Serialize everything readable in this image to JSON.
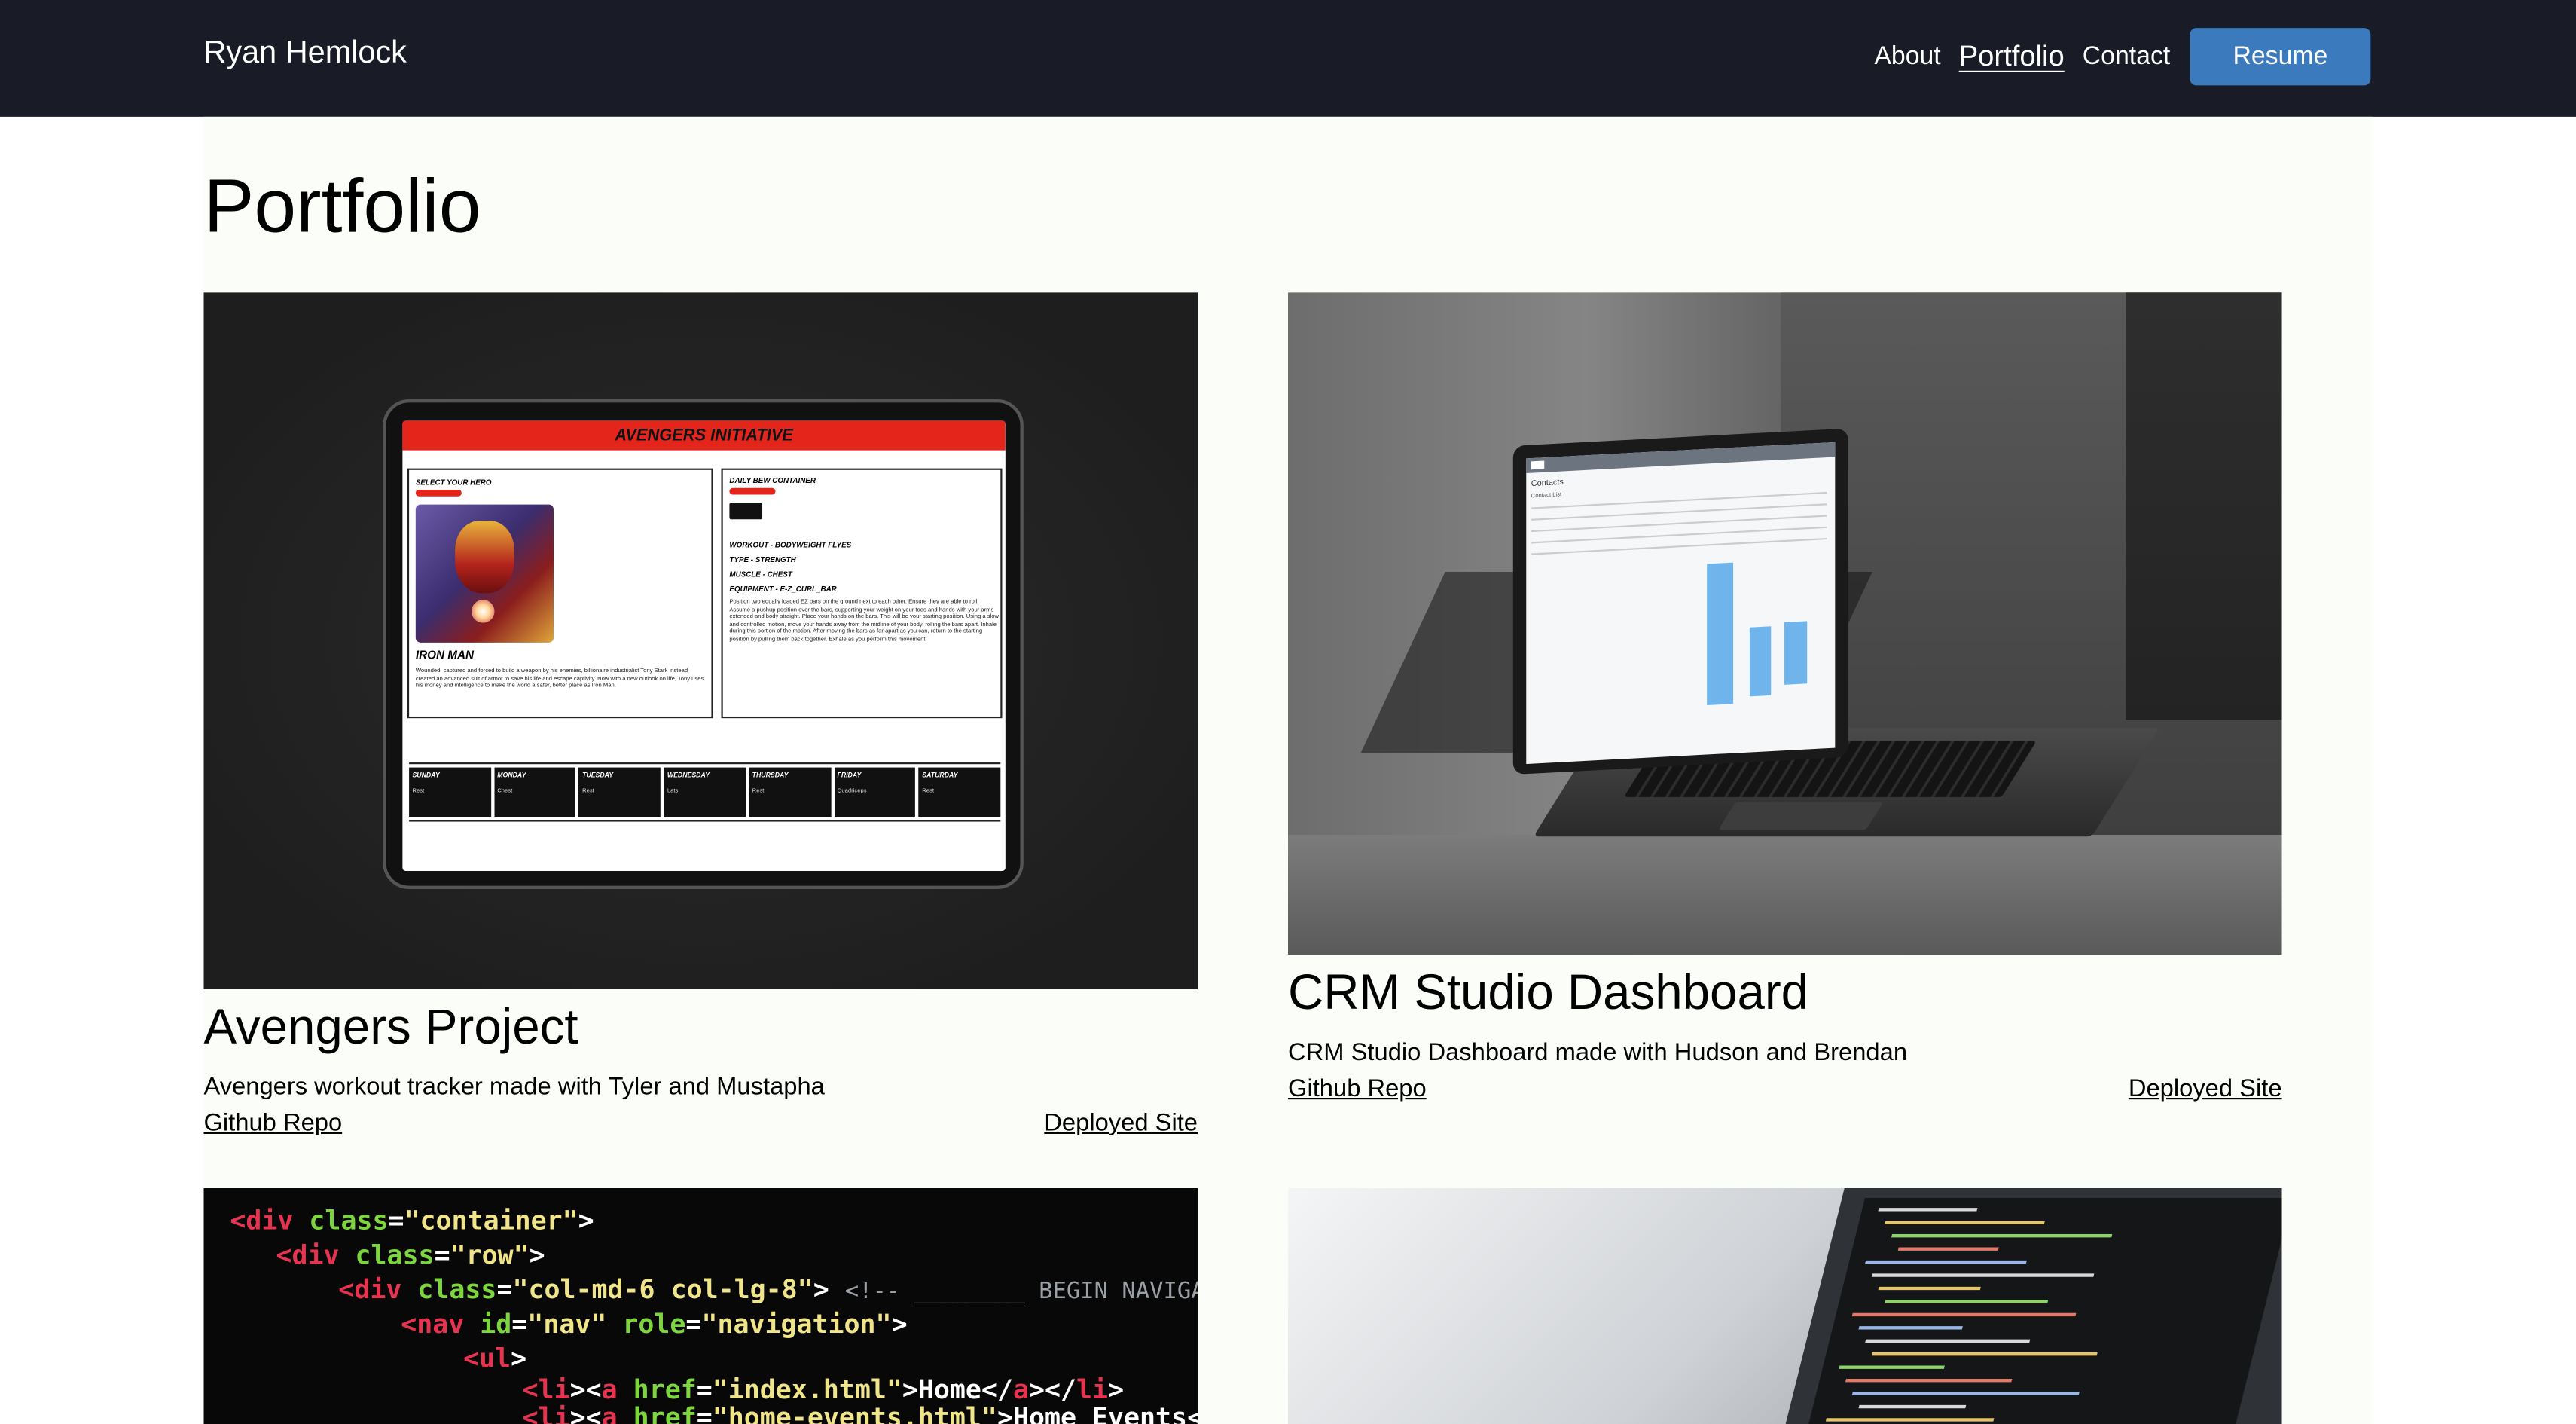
{
  "nav": {
    "brand": "Ryan Hemlock",
    "links": [
      "About",
      "Portfolio",
      "Contact"
    ],
    "active": "Portfolio",
    "resume_label": "Resume",
    "colors": {
      "bar": "#191b26",
      "button": "#3b7bbd"
    }
  },
  "page": {
    "title": "Portfolio"
  },
  "projects": [
    {
      "title": "Avengers Project",
      "description": "Avengers workout tracker made with Tyler and Mustapha",
      "repo_label": "Github Repo",
      "site_label": "Deployed Site",
      "mockup": {
        "header": "AVENGERS INITIATIVE",
        "select_label": "SELECT YOUR HERO",
        "hero_name": "IRON MAN",
        "hero_bio": "Wounded, captured and forced to build a weapon by his enemies, billionaire industrialist Tony Stark instead created an advanced suit of armor to save his life and escape captivity. Now with a new outlook on life, Tony uses his money and intelligence to make the world a safer, better place as Iron Man.",
        "daily_label": "DAILY BEW CONTAINER",
        "workout_lines": [
          "WORKOUT - BODYWEIGHT FLYES",
          "TYPE - STRENGTH",
          "MUSCLE - CHEST",
          "EQUIPMENT - E-Z_CURL_BAR"
        ],
        "instructions": "Position two equally loaded EZ bars on the ground next to each other. Ensure they are able to roll. Assume a pushup position over the bars, supporting your weight on your toes and hands with your arms extended and body straight. Place your hands on the bars. This will be your starting position. Using a slow and controlled motion, move your hands away from the midline of your body, rolling the bars apart. Inhale during this portion of the motion. After moving the bars as far apart as you can, return to the starting position by pulling them back together. Exhale as you perform this movement.",
        "days": [
          {
            "name": "SUNDAY",
            "value": "Rest"
          },
          {
            "name": "MONDAY",
            "value": "Chest"
          },
          {
            "name": "TUESDAY",
            "value": "Rest"
          },
          {
            "name": "WEDNESDAY",
            "value": "Lats"
          },
          {
            "name": "THURSDAY",
            "value": "Rest"
          },
          {
            "name": "FRIDAY",
            "value": "Quadriceps"
          },
          {
            "name": "SATURDAY",
            "value": "Rest"
          }
        ]
      }
    },
    {
      "title": "CRM Studio Dashboard",
      "description": "CRM Studio Dashboard made with Hudson and Brendan",
      "repo_label": "Github Repo",
      "site_label": "Deployed Site",
      "mockup": {
        "section": "Contacts",
        "sub": "Contact List"
      }
    },
    {
      "code_lines": [
        {
          "segments": [
            [
              "tag",
              "<div "
            ],
            [
              "attr",
              "class"
            ],
            [
              "plain",
              "="
            ],
            [
              "str",
              "\"container\""
            ],
            [
              "plain",
              ">"
            ]
          ]
        },
        {
          "segments": [
            [
              "tag",
              "<div "
            ],
            [
              "attr",
              "class"
            ],
            [
              "plain",
              "="
            ],
            [
              "str",
              "\"row\""
            ],
            [
              "plain",
              ">"
            ]
          ]
        },
        {
          "segments": [
            [
              "tag",
              "<div "
            ],
            [
              "attr",
              "class"
            ],
            [
              "plain",
              "="
            ],
            [
              "str",
              "\"col-md-6 col-lg-8\""
            ],
            [
              "plain",
              "> "
            ],
            [
              "dim",
              "<!-- ________ BEGIN NAVIGATION"
            ]
          ]
        },
        {
          "segments": [
            [
              "tag",
              "<nav "
            ],
            [
              "attr",
              "id"
            ],
            [
              "plain",
              "="
            ],
            [
              "str",
              "\"nav\" "
            ],
            [
              "attr",
              "role"
            ],
            [
              "plain",
              "="
            ],
            [
              "str",
              "\"navigation\""
            ],
            [
              "plain",
              ">"
            ]
          ]
        },
        {
          "segments": [
            [
              "tag",
              "<ul"
            ],
            [
              "plain",
              ">"
            ]
          ]
        },
        {
          "segments": [
            [
              "tag",
              "<li"
            ],
            [
              "plain",
              "><"
            ],
            [
              "tag",
              "a "
            ],
            [
              "attr",
              "href"
            ],
            [
              "plain",
              "="
            ],
            [
              "str",
              "\"index.html\""
            ],
            [
              "plain",
              ">Home</"
            ],
            [
              "tag",
              "a"
            ],
            [
              "plain",
              "></"
            ],
            [
              "tag",
              "li"
            ],
            [
              "plain",
              ">"
            ]
          ]
        },
        {
          "segments": [
            [
              "tag",
              "<li"
            ],
            [
              "plain",
              "><"
            ],
            [
              "tag",
              "a "
            ],
            [
              "attr",
              "href"
            ],
            [
              "plain",
              "="
            ],
            [
              "str",
              "\"home-events.html\""
            ],
            [
              "plain",
              ">Home Events</"
            ],
            [
              "tag",
              "a"
            ],
            [
              "plain",
              "></"
            ],
            [
              "tag",
              "li"
            ],
            [
              "plain",
              ">"
            ]
          ]
        }
      ]
    }
  ]
}
